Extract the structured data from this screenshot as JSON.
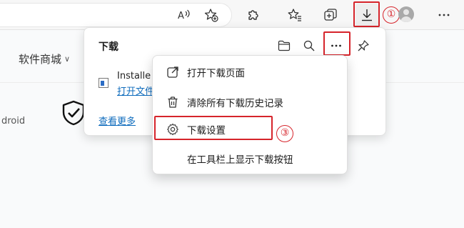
{
  "toolbar": {
    "icons": [
      "read-aloud-icon",
      "add-favorite-icon",
      "extensions-icon",
      "favorites-icon",
      "collections-icon",
      "download-icon",
      "profile-icon",
      "more-icon"
    ]
  },
  "annotations": {
    "step1": "①",
    "step2": "②",
    "step3": "③",
    "color": "#d6242b"
  },
  "page": {
    "nav_label": "软件商城",
    "nav_chevron": "∨",
    "side_text": "droid"
  },
  "downloads_panel": {
    "title": "下载",
    "file_name": "Installe",
    "file_action": "打开文件",
    "see_more": "查看更多",
    "link_color": "#0f6cbd"
  },
  "menu": {
    "items": [
      {
        "label": "打开下载页面",
        "icon": "open-external-icon"
      },
      {
        "label": "清除所有下载历史记录",
        "icon": "trash-icon"
      },
      {
        "label": "下载设置",
        "icon": "gear-icon"
      },
      {
        "label": "在工具栏上显示下载按钮",
        "icon": ""
      }
    ]
  }
}
